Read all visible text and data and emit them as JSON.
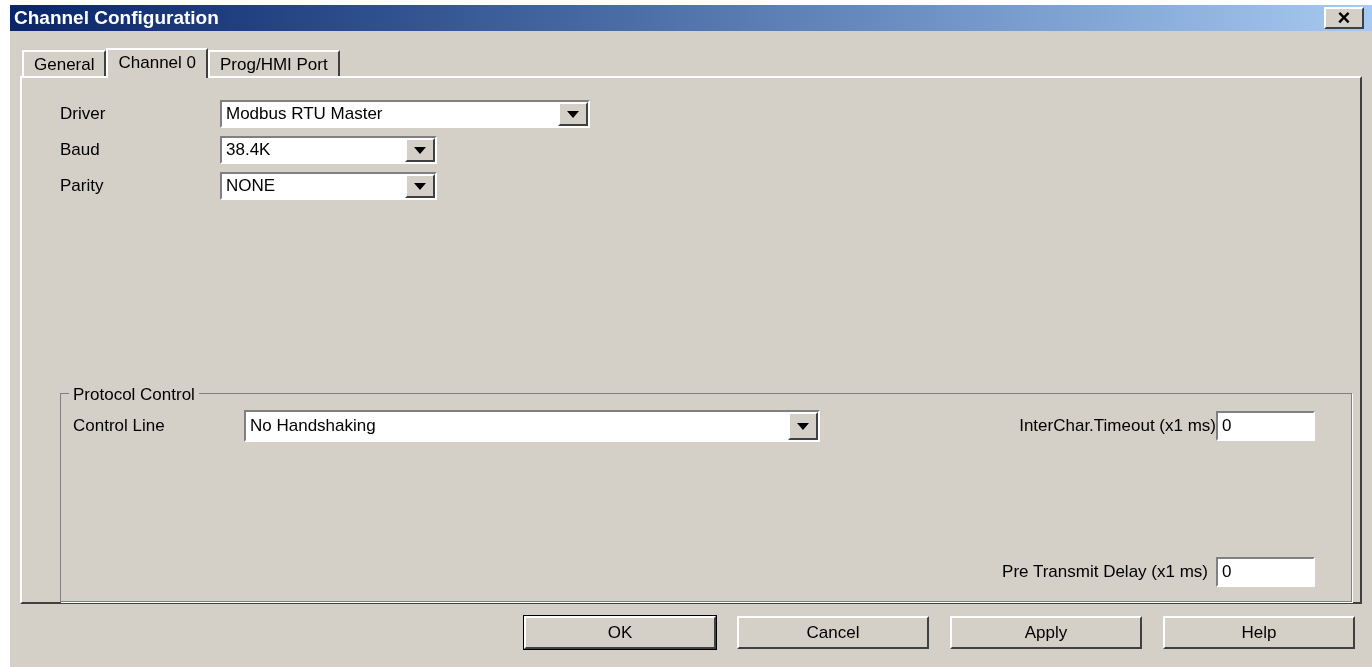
{
  "window": {
    "title": "Channel Configuration",
    "close": "×"
  },
  "tabs": [
    {
      "label": "General",
      "selected": false
    },
    {
      "label": "Channel 0",
      "selected": true
    },
    {
      "label": "Prog/HMI Port",
      "selected": false
    }
  ],
  "fields": [
    {
      "label": "Driver",
      "value": "Modbus RTU Master",
      "wide": true
    },
    {
      "label": "Baud",
      "value": "38.4K",
      "wide": false
    },
    {
      "label": "Parity",
      "value": "NONE",
      "wide": false
    }
  ],
  "protocol_control": {
    "title": "Protocol Control",
    "control_line": {
      "label": "Control Line",
      "value": "No Handshaking"
    },
    "interchar_timeout": {
      "label": "InterChar.Timeout (x1 ms)",
      "value": "0"
    },
    "pre_transmit_delay": {
      "label": "Pre Transmit Delay (x1 ms)",
      "value": "0"
    }
  },
  "buttons": [
    {
      "label": "OK",
      "default": true
    },
    {
      "label": "Cancel",
      "default": false
    },
    {
      "label": "Apply",
      "default": false
    },
    {
      "label": "Help",
      "default": false
    }
  ]
}
